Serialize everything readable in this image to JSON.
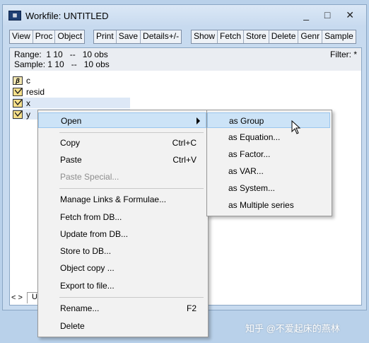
{
  "window": {
    "app_icon": "eviews-workfile-icon",
    "title": "Workfile: UNTITLED",
    "controls_text": "_ □ ✕"
  },
  "toolbar": {
    "group1": [
      "View",
      "Proc",
      "Object"
    ],
    "group2": [
      "Print",
      "Save",
      "Details+/-"
    ],
    "group3": [
      "Show",
      "Fetch",
      "Store",
      "Delete",
      "Genr",
      "Sample"
    ]
  },
  "info": {
    "range_text": "Range:  1 10   --   10 obs",
    "sample_text": "Sample: 1 10   --   10 obs",
    "filter_text": "Filter: *"
  },
  "objects": [
    {
      "name": "c",
      "icon": "coefficient-vector-icon"
    },
    {
      "name": "resid",
      "icon": "series-icon"
    },
    {
      "name": "x",
      "icon": "series-icon"
    },
    {
      "name": "y",
      "icon": "series-icon"
    }
  ],
  "bottom_tabs": {
    "nav": "< >",
    "tab": "U"
  },
  "context_menu": {
    "open": "Open",
    "copy": "Copy",
    "copy_shortcut": "Ctrl+C",
    "paste": "Paste",
    "paste_shortcut": "Ctrl+V",
    "paste_special": "Paste Special...",
    "manage_links": "Manage Links & Formulae...",
    "fetch_from_db": "Fetch from DB...",
    "update_from_db": "Update from DB...",
    "store_to_db": "Store to DB...",
    "object_copy": "Object copy ...",
    "export_to_file": "Export to file...",
    "rename": "Rename...",
    "rename_shortcut": "F2",
    "delete": "Delete"
  },
  "submenu": {
    "as_group": "as Group",
    "as_equation": "as Equation...",
    "as_factor": "as Factor...",
    "as_var": "as VAR...",
    "as_system": "as System...",
    "as_multiple_series": "as Multiple series"
  },
  "watermark": "知乎 @不爱起床的燕林",
  "colors": {
    "desktop": "#b9d1ea",
    "menu_highlight": "#cce3f7",
    "selection": "#dde8f6"
  }
}
